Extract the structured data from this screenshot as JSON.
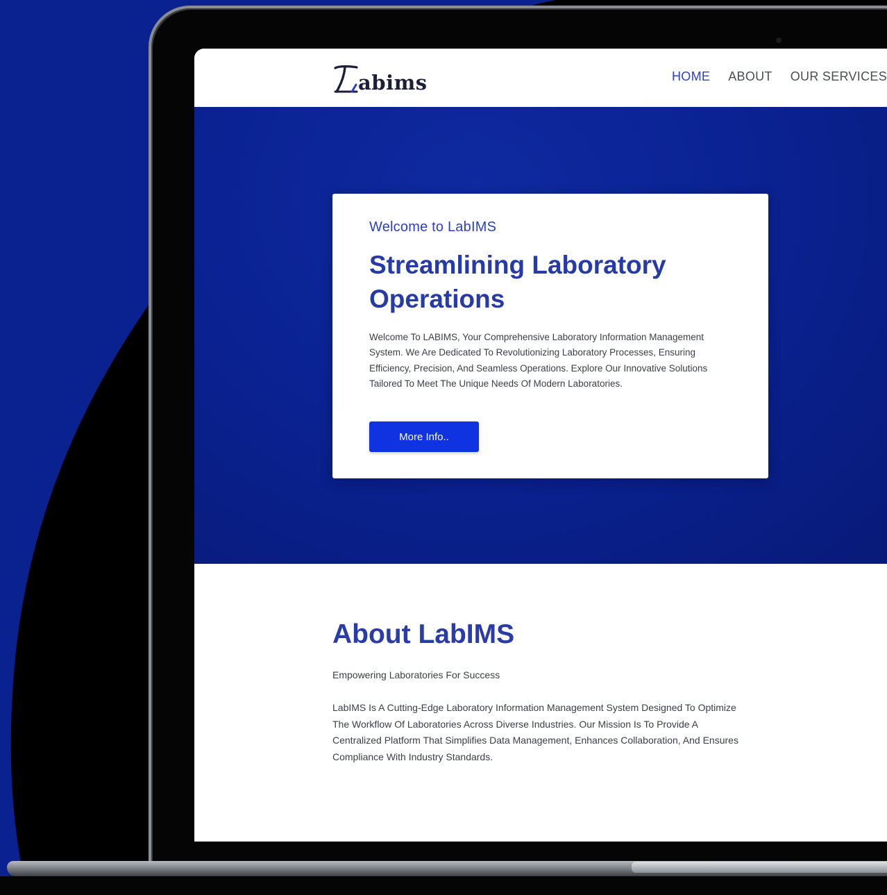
{
  "colors": {
    "navy_background": "#0a2290",
    "brand_blue": "#0f33e0",
    "heading_blue": "#263aa8",
    "nav_active": "#2b3fd6"
  },
  "header": {
    "logo_icon": "labims-logo-icon",
    "logo_text": "abims",
    "nav": [
      {
        "label": "HOME",
        "active": true
      },
      {
        "label": "ABOUT",
        "active": false
      },
      {
        "label": "OUR SERVICES",
        "active": false
      }
    ]
  },
  "hero": {
    "kicker": "Welcome to LabIMS",
    "title": "Streamlining Laboratory Operations",
    "body": "Welcome To LABIMS, Your Comprehensive Laboratory Information Management System. We Are Dedicated To Revolutionizing Laboratory Processes, Ensuring Efficiency, Precision, And Seamless Operations. Explore Our Innovative Solutions Tailored To Meet The Unique Needs Of Modern Laboratories.",
    "button_label": "More Info.."
  },
  "about": {
    "title": "About LabIMS",
    "subtitle": "Empowering Laboratories For Success",
    "body": "LabIMS Is A Cutting-Edge Laboratory Information Management System Designed To Optimize The Workflow Of Laboratories Across Diverse Industries. Our Mission Is To Provide A Centralized Platform That Simplifies Data Management, Enhances Collaboration, And Ensures Compliance With Industry Standards."
  }
}
